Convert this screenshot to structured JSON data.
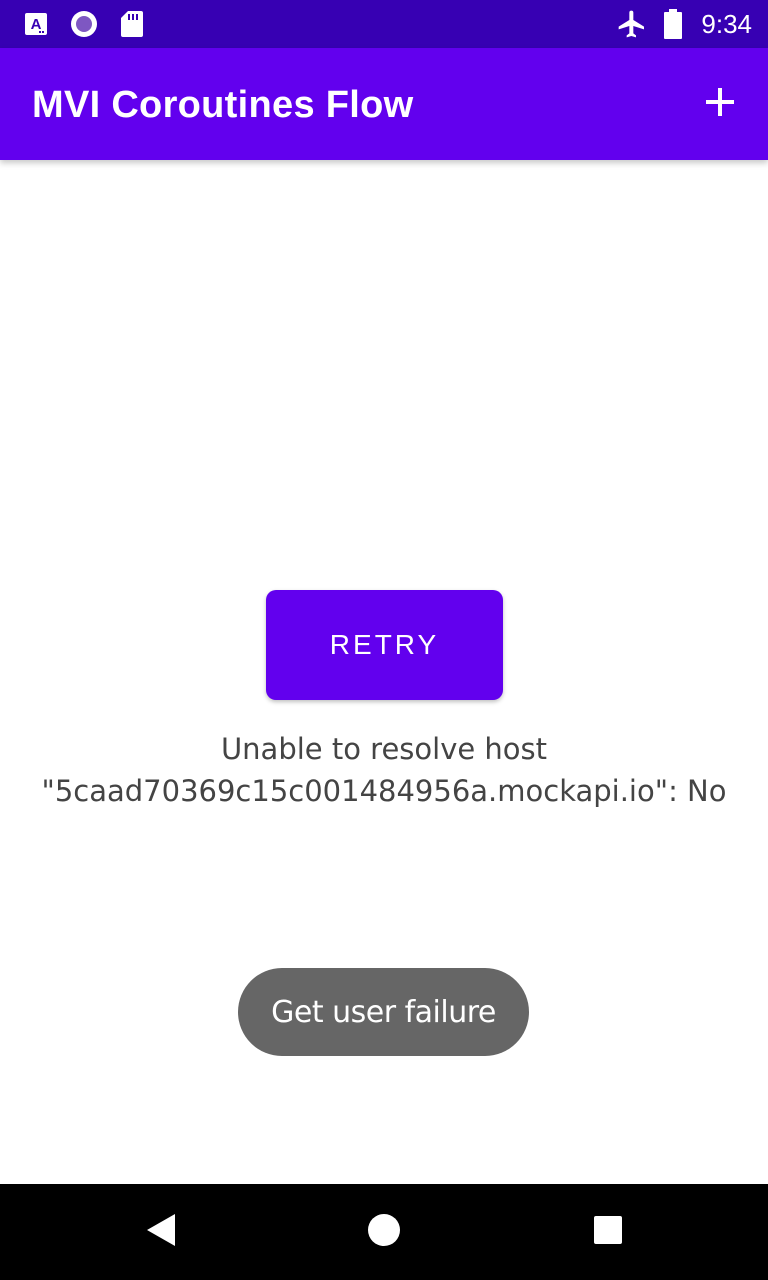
{
  "status_bar": {
    "time": "9:34",
    "icons": [
      "accessibility-a-icon",
      "record-circle-icon",
      "sd-card-icon",
      "airplane-mode-icon",
      "battery-icon"
    ]
  },
  "app_bar": {
    "title": "MVI Coroutines Flow",
    "action_icon": "add-icon"
  },
  "content": {
    "retry_label": "RETRY",
    "error_message": "Unable to resolve host \"5caad70369c15c001484956a.mockapi.io\": No"
  },
  "toast": {
    "message": "Get user failure"
  },
  "nav_bar": {
    "icons": [
      "back-icon",
      "home-icon",
      "recents-icon"
    ]
  },
  "colors": {
    "status_bar": "#3700B3",
    "primary": "#6200EE",
    "toast": "#666666",
    "text": "#444444"
  }
}
